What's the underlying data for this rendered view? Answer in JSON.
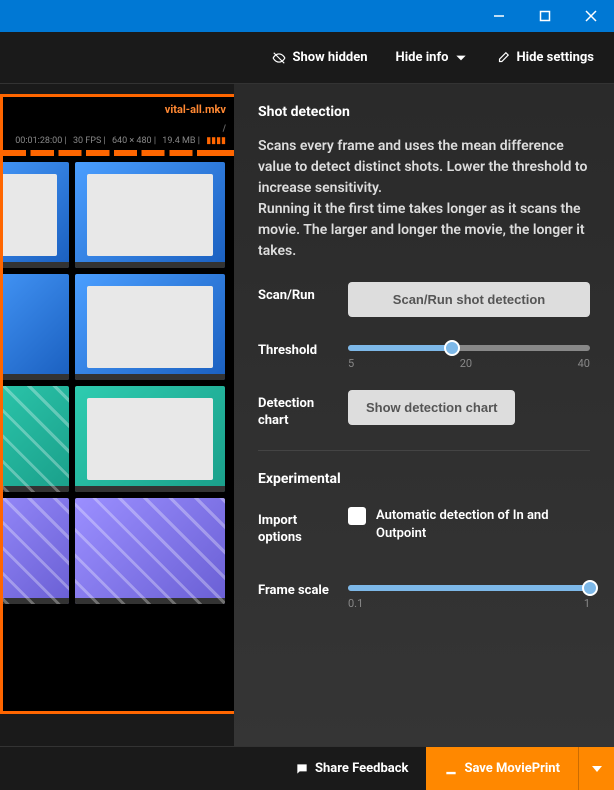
{
  "titlebar": {
    "minimize": "minimize",
    "maximize": "maximize",
    "close": "close"
  },
  "toolbar": {
    "show_hidden": "Show hidden",
    "hide_info": "Hide info",
    "hide_settings": "Hide settings"
  },
  "media": {
    "filename": "vital-all.mkv",
    "path": "/",
    "duration": "00:01:28:00",
    "fps": "30 FPS",
    "resolution": "640 × 480",
    "size": "19.4 MB"
  },
  "settings": {
    "shot_detection_title": "Shot detection",
    "shot_detection_desc_1": "Scans every frame and uses the mean difference value to detect distinct shots. Lower the threshold to increase sensitivity.",
    "shot_detection_desc_2": "Running it the first time takes longer as it scans the movie. The larger and longer the movie, the longer it takes.",
    "scan_run_label": "Scan/Run",
    "scan_run_button": "Scan/Run shot detection",
    "threshold_label": "Threshold",
    "threshold": {
      "min": 5,
      "mid": 20,
      "max": 40,
      "value": 20
    },
    "detection_chart_label": "Detection chart",
    "detection_chart_button": "Show detection chart",
    "experimental_title": "Experimental",
    "import_options_label": "Import options",
    "import_options_check": "Automatic detection of In and Outpoint",
    "frame_scale_label": "Frame scale",
    "frame_scale": {
      "min": 0.1,
      "max": 1,
      "value": 1
    }
  },
  "footer": {
    "share_feedback": "Share Feedback",
    "save": "Save MoviePrint"
  }
}
